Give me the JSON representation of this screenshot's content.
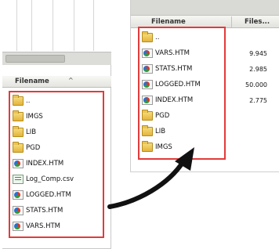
{
  "left_pane": {
    "header": {
      "column": "Filename",
      "sort_indicator": "^"
    },
    "files": [
      {
        "name": "..",
        "type": "folder"
      },
      {
        "name": "IMGS",
        "type": "folder"
      },
      {
        "name": "LIB",
        "type": "folder"
      },
      {
        "name": "PGD",
        "type": "folder"
      },
      {
        "name": "INDEX.HTM",
        "type": "htm"
      },
      {
        "name": "Log_Comp.csv",
        "type": "csv"
      },
      {
        "name": "LOGGED.HTM",
        "type": "htm"
      },
      {
        "name": "STATS.HTM",
        "type": "htm"
      },
      {
        "name": "VARS.HTM",
        "type": "htm"
      }
    ]
  },
  "right_pane": {
    "header": {
      "name_column": "Filename",
      "size_column": "Files..."
    },
    "files": [
      {
        "name": "..",
        "type": "folder",
        "size": ""
      },
      {
        "name": "VARS.HTM",
        "type": "htm",
        "size": "9.945"
      },
      {
        "name": "STATS.HTM",
        "type": "htm",
        "size": "2.985"
      },
      {
        "name": "LOGGED.HTM",
        "type": "htm",
        "size": "50.000"
      },
      {
        "name": "INDEX.HTM",
        "type": "htm",
        "size": "2.775"
      },
      {
        "name": "PGD",
        "type": "folder",
        "size": ""
      },
      {
        "name": "LIB",
        "type": "folder",
        "size": ""
      },
      {
        "name": "IMGS",
        "type": "folder",
        "size": ""
      }
    ]
  },
  "colors": {
    "highlight": "#e23b3b",
    "arrow": "#111111"
  },
  "icons": {
    "folder": "folder-icon",
    "htm": "html-file-icon",
    "csv": "csv-file-icon"
  }
}
